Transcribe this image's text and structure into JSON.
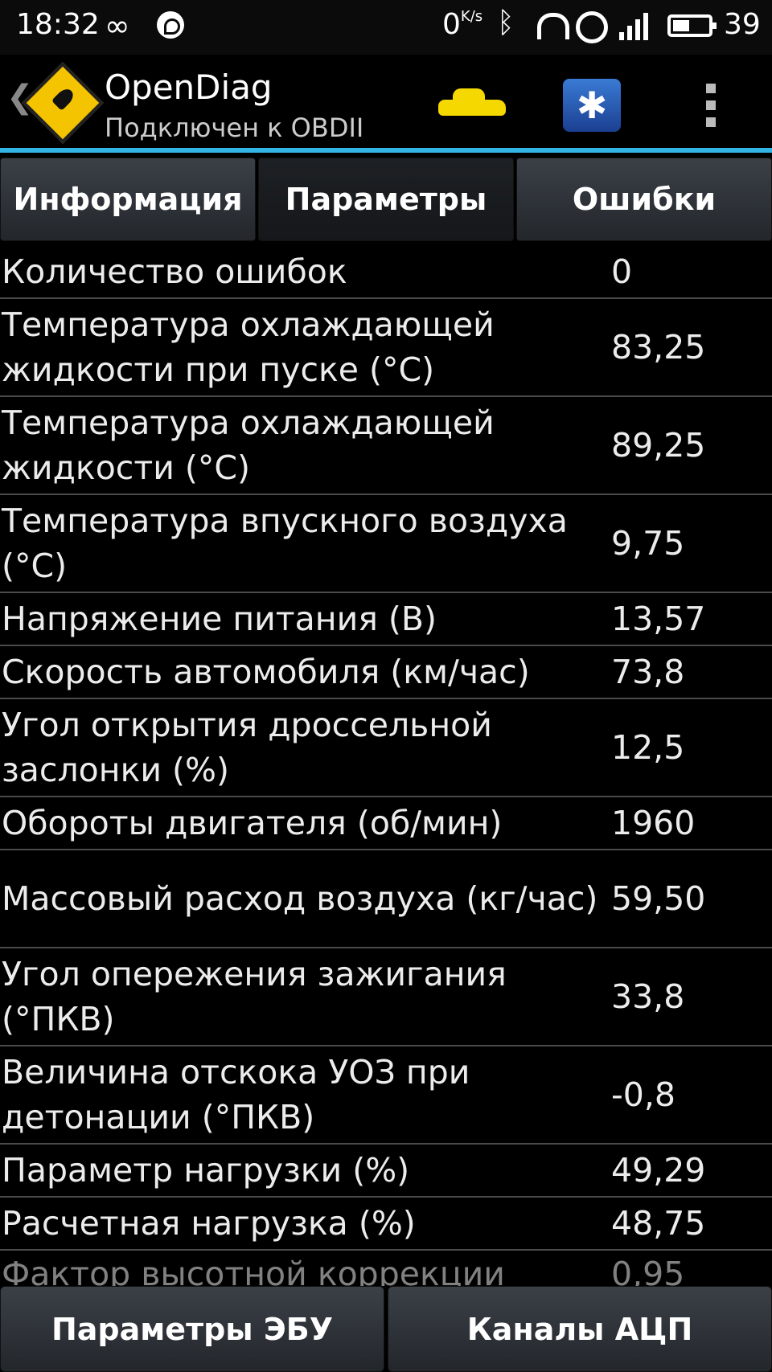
{
  "status_bar": {
    "time": "18:32",
    "net_speed": "0",
    "net_speed_unit": "K/s",
    "battery": "39"
  },
  "action_bar": {
    "title": "OpenDiag",
    "subtitle": "Подключен к OBDII"
  },
  "tabs": [
    {
      "label": "Информация"
    },
    {
      "label": "Параметры"
    },
    {
      "label": "Ошибки"
    }
  ],
  "params": [
    {
      "label": "Количество ошибок",
      "value": "0"
    },
    {
      "label": "Температура охлаждающей жидкости при пуске (°C)",
      "value": "83,25"
    },
    {
      "label": "Температура охлаждающей жидкости (°C)",
      "value": "89,25"
    },
    {
      "label": "Температура впускного воздуха (°C)",
      "value": "9,75"
    },
    {
      "label": "Напряжение питания (В)",
      "value": "13,57"
    },
    {
      "label": "Скорость автомобиля (км/час)",
      "value": "73,8"
    },
    {
      "label": "Угол открытия дроссельной заслонки (%)",
      "value": "12,5"
    },
    {
      "label": "Обороты двигателя (об/мин)",
      "value": "1960"
    },
    {
      "label": "Массовый расход воздуха (кг/час)",
      "value": "59,50"
    },
    {
      "label": "Угол опережения зажигания (°ПКВ)",
      "value": "33,8"
    },
    {
      "label": "Величина отскока УОЗ при детонации (°ПКВ)",
      "value": "-0,8"
    },
    {
      "label": "Параметр нагрузки (%)",
      "value": "49,29"
    },
    {
      "label": "Расчетная нагрузка (%)",
      "value": "48,75"
    },
    {
      "label": "Фактор высотной коррекции",
      "value": "0,95"
    }
  ],
  "bottom_buttons": [
    {
      "label": "Параметры ЭБУ"
    },
    {
      "label": "Каналы АЦП"
    }
  ],
  "colors": {
    "accent": "#33b5e5",
    "background": "#000000",
    "tab_bg": "#2f3339"
  }
}
